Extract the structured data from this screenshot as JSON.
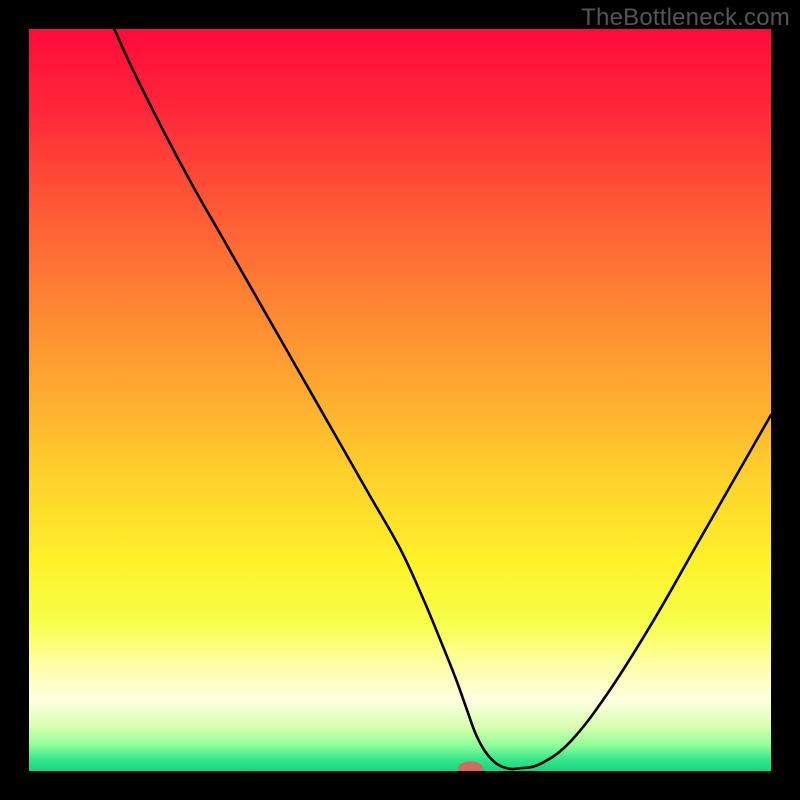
{
  "watermark": "TheBottleneck.com",
  "chart_data": {
    "type": "line",
    "title": "",
    "xlabel": "",
    "ylabel": "",
    "xlim": [
      0,
      100
    ],
    "ylim": [
      0,
      100
    ],
    "background_gradient": {
      "stops": [
        {
          "offset": 0.0,
          "color": "#ff0b3b"
        },
        {
          "offset": 0.1,
          "color": "#ff243a"
        },
        {
          "offset": 0.22,
          "color": "#ff5136"
        },
        {
          "offset": 0.35,
          "color": "#ff7e33"
        },
        {
          "offset": 0.48,
          "color": "#ffa730"
        },
        {
          "offset": 0.6,
          "color": "#ffd02c"
        },
        {
          "offset": 0.72,
          "color": "#fff22a"
        },
        {
          "offset": 0.8,
          "color": "#f7ff4a"
        },
        {
          "offset": 0.86,
          "color": "#ffffad"
        },
        {
          "offset": 0.905,
          "color": "#ffffe0"
        },
        {
          "offset": 0.94,
          "color": "#d9ffb0"
        },
        {
          "offset": 0.965,
          "color": "#8fff9a"
        },
        {
          "offset": 0.985,
          "color": "#33e68a"
        },
        {
          "offset": 1.0,
          "color": "#18d47e"
        }
      ]
    },
    "series": [
      {
        "name": "bottleneck-curve",
        "x": [
          11.5,
          14,
          18,
          22,
          26,
          30,
          34,
          38,
          42,
          46,
          50,
          53,
          55.5,
          57.5,
          59,
          60.2,
          61.5,
          63,
          64.5,
          66,
          69,
          73,
          78,
          84,
          90,
          96,
          100
        ],
        "y": [
          100,
          94.5,
          86.5,
          79,
          72,
          65,
          58,
          51,
          44,
          37,
          30,
          23.5,
          17.5,
          12.5,
          8.3,
          5.0,
          2.6,
          1.0,
          0.35,
          0.35,
          1.0,
          4.0,
          10.5,
          20.0,
          30.5,
          41.0,
          48.0
        ],
        "color": "#000000",
        "width": 2.6
      }
    ],
    "flat_segment": {
      "x0": 57.8,
      "x1": 61.2,
      "y": 0.35
    },
    "marker": {
      "name": "optimal-point",
      "x": 59.5,
      "y": 0.35,
      "rx": 1.7,
      "ry": 0.95,
      "color": "#d46a5e"
    }
  }
}
